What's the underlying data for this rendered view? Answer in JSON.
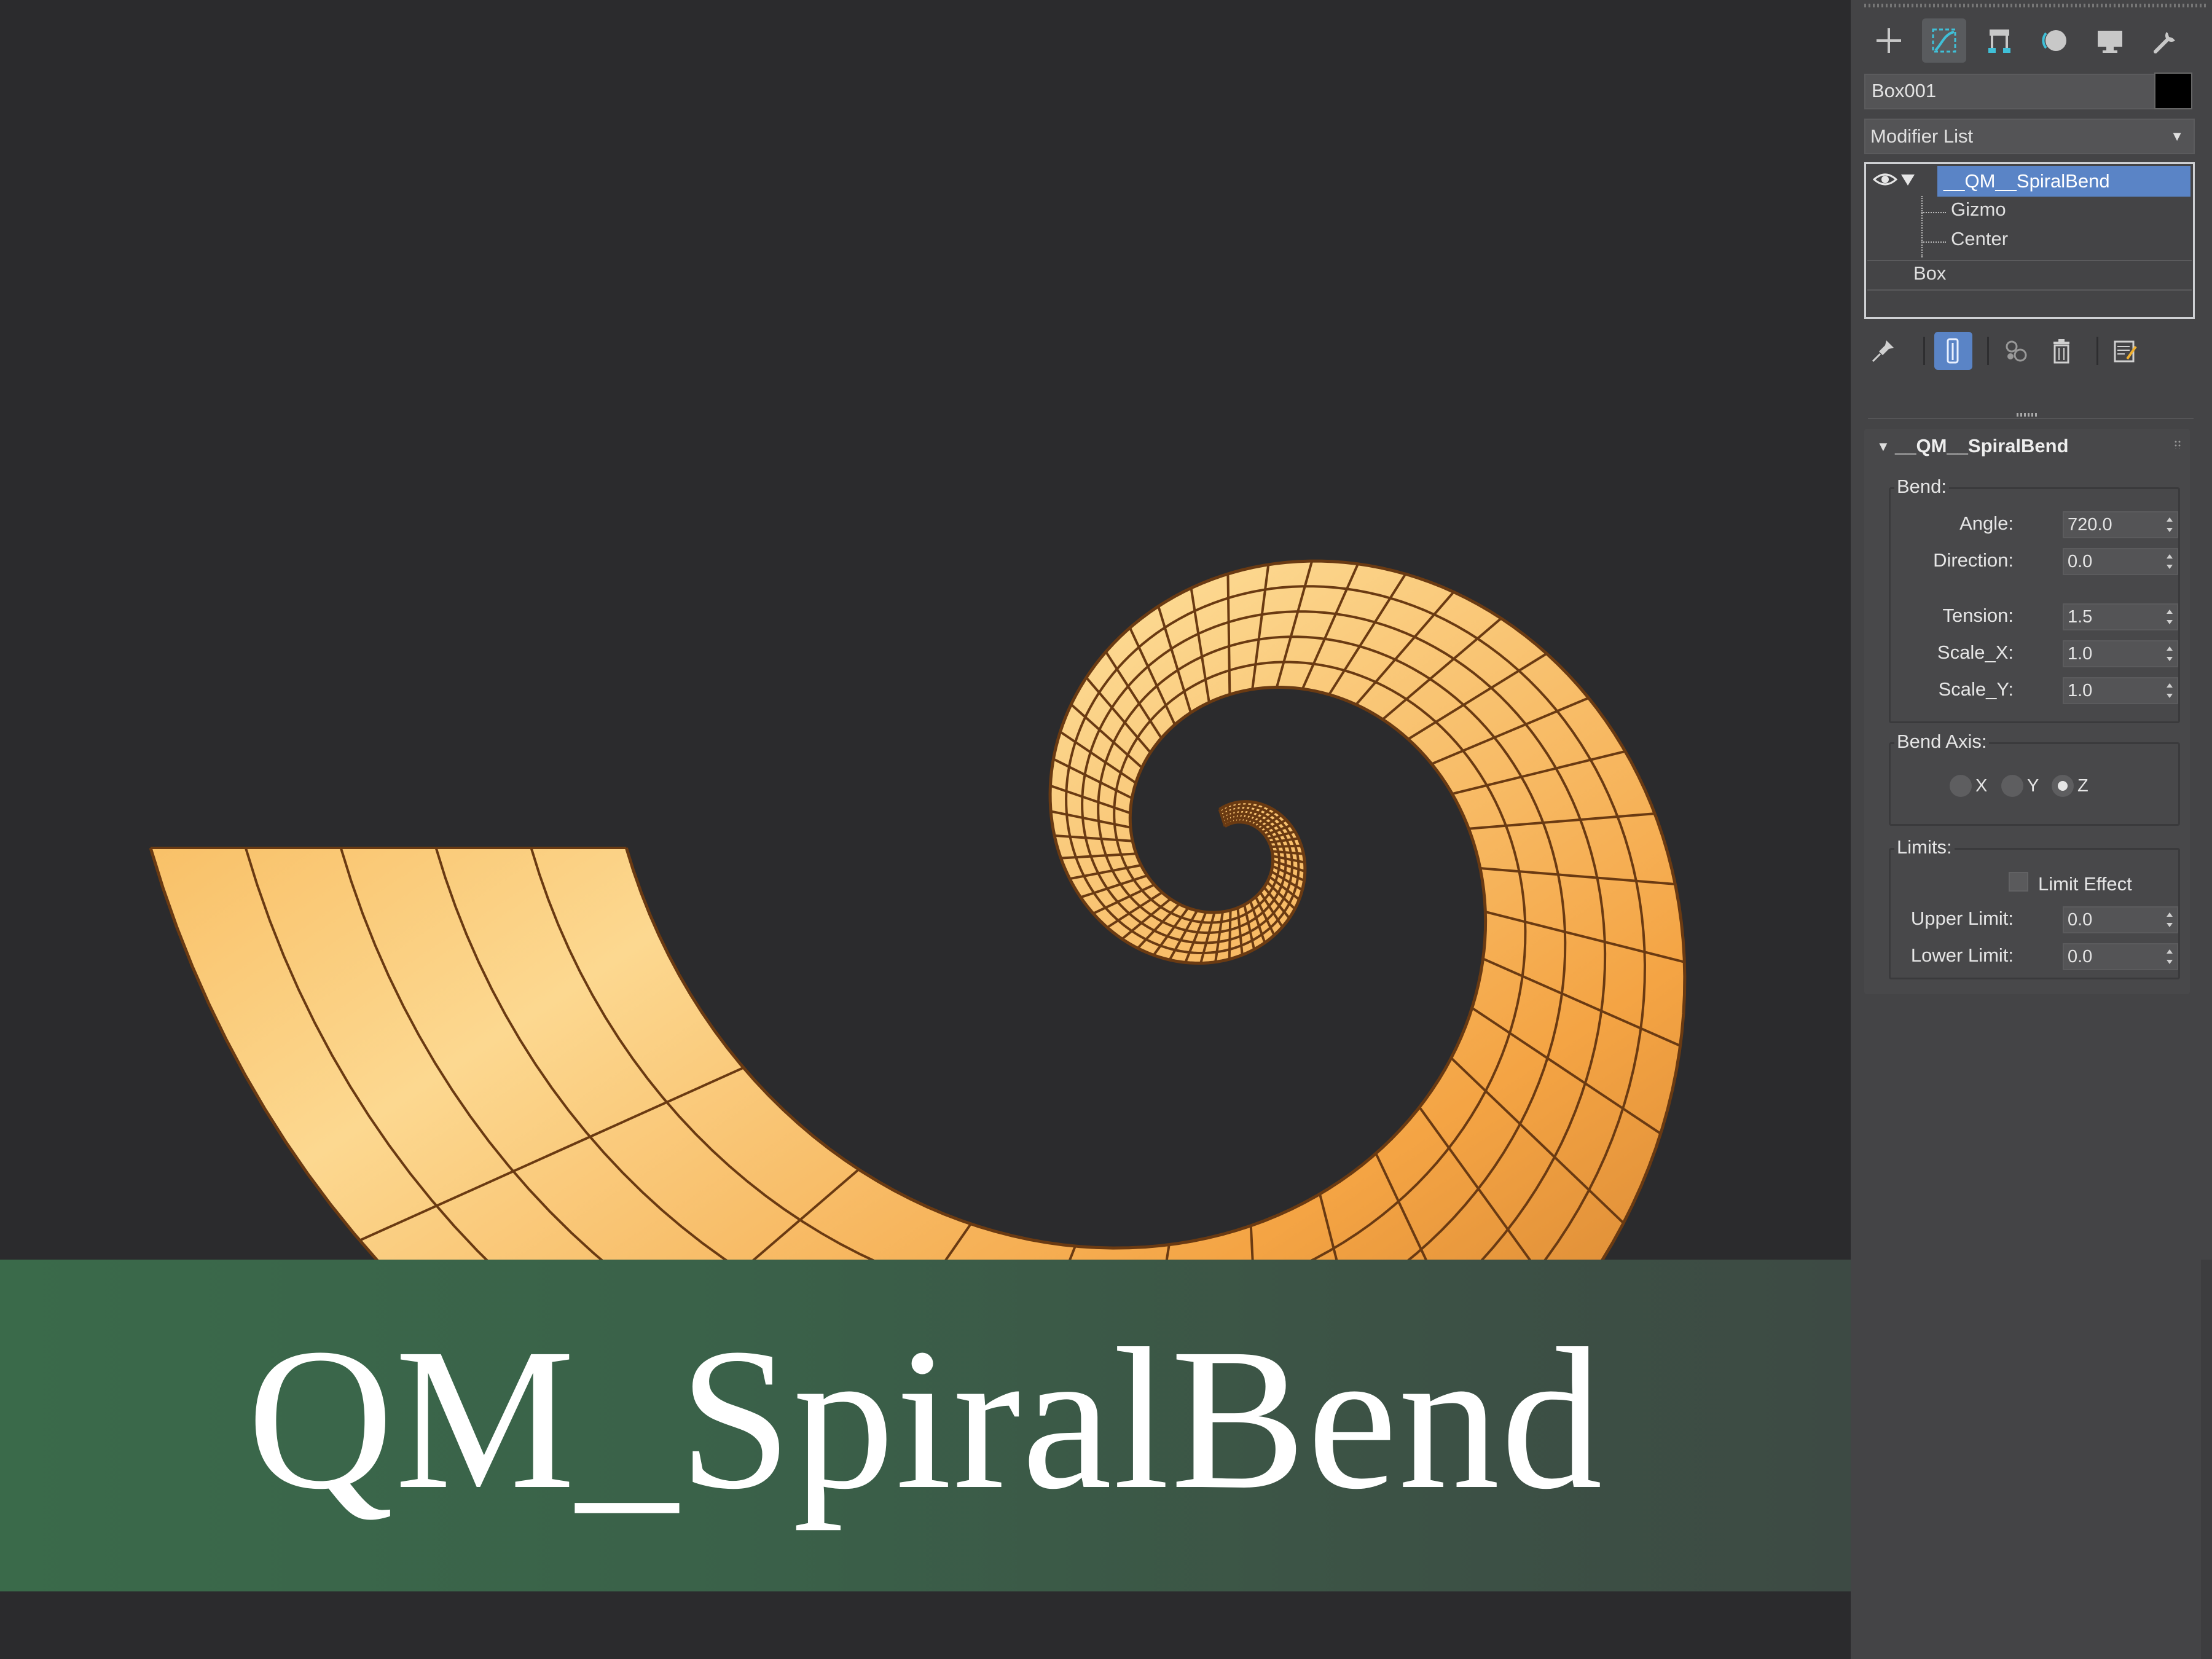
{
  "title_banner": {
    "text": "QM_SpiralBend"
  },
  "command_panel": {
    "tabs": [
      "create-icon",
      "modify-icon",
      "hierarchy-icon",
      "motion-icon",
      "display-icon",
      "utilities-icon"
    ],
    "object_name": "Box001",
    "object_color": "#000000",
    "modifier_list": {
      "label": "Modifier List"
    },
    "stack": {
      "modifier": "__QM__SpiralBend",
      "sub_items": [
        "Gizmo",
        "Center"
      ],
      "base_object": "Box"
    },
    "rollout": {
      "title": "__QM__SpiralBend",
      "bend_group": {
        "label": "Bend:",
        "angle": {
          "label": "Angle:",
          "value": "720.0"
        },
        "direction": {
          "label": "Direction:",
          "value": "0.0"
        },
        "tension": {
          "label": "Tension:",
          "value": "1.5"
        },
        "scale_x": {
          "label": "Scale_X:",
          "value": "1.0"
        },
        "scale_y": {
          "label": "Scale_Y:",
          "value": "1.0"
        }
      },
      "bend_axis_group": {
        "label": "Bend Axis:",
        "options": [
          "X",
          "Y",
          "Z"
        ],
        "selected": "Z"
      },
      "limits_group": {
        "label": "Limits:",
        "limit_effect": {
          "label": "Limit Effect",
          "checked": false
        },
        "upper_limit": {
          "label": "Upper Limit:",
          "value": "0.0"
        },
        "lower_limit": {
          "label": "Lower Limit:",
          "value": "0.0"
        }
      }
    }
  },
  "colors": {
    "accent": "#5a84c6",
    "mesh_orange": "#f5a540",
    "mesh_wire": "#6a3a12",
    "banner_green": "#3a6a4a",
    "viewport_bg": "#2b2b2d"
  }
}
